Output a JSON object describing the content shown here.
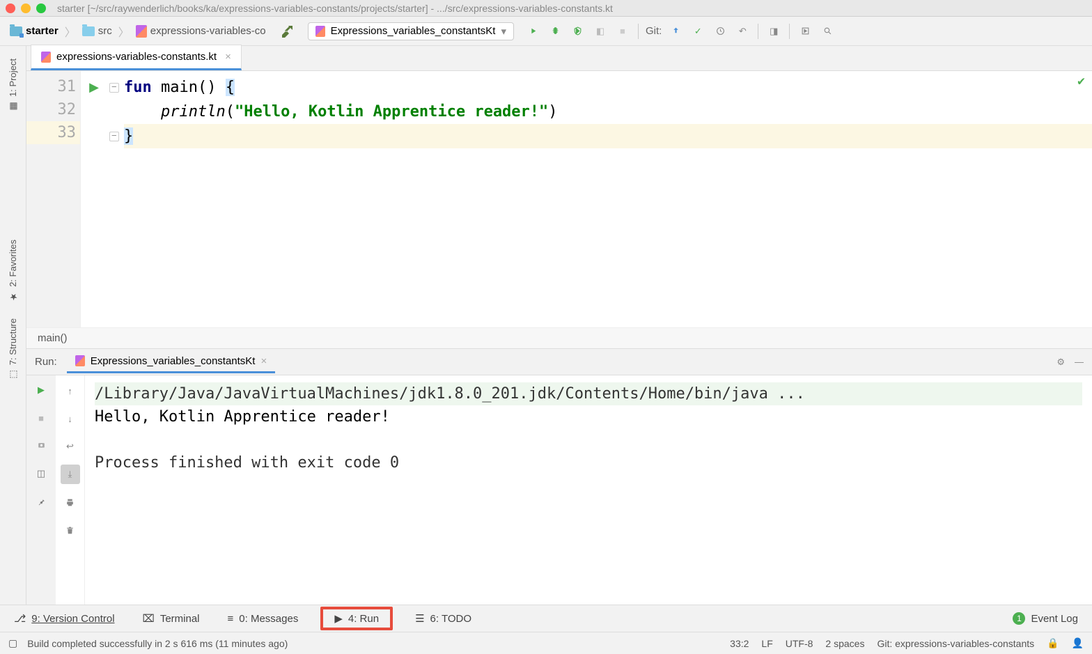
{
  "titlebar": {
    "title": "starter [~/src/raywenderlich/books/ka/expressions-variables-constants/projects/starter] - .../src/expressions-variables-constants.kt"
  },
  "breadcrumb": {
    "project": "starter",
    "folder": "src",
    "file": "expressions-variables-co"
  },
  "run_config": {
    "name": "Expressions_variables_constantsKt"
  },
  "git_label": "Git:",
  "editor": {
    "tab_name": "expressions-variables-constants.kt",
    "line_numbers": [
      "31",
      "32",
      "33"
    ],
    "code": {
      "line1_kw": "fun",
      "line1_rest": " main() ",
      "line1_brace": "{",
      "line2_indent": "    ",
      "line2_fn": "println",
      "line2_open": "(",
      "line2_str": "\"Hello, Kotlin Apprentice reader!\"",
      "line2_close": ")",
      "line3_brace": "}"
    },
    "breadcrumb": "main()"
  },
  "side_tabs": {
    "project": "1: Project",
    "favorites": "2: Favorites",
    "structure": "7: Structure"
  },
  "run_panel": {
    "label": "Run:",
    "tab": "Expressions_variables_constantsKt",
    "console": {
      "cmd": "/Library/Java/JavaVirtualMachines/jdk1.8.0_201.jdk/Contents/Home/bin/java ...",
      "out": "Hello, Kotlin Apprentice reader!",
      "exit": "Process finished with exit code 0"
    }
  },
  "bottom_bar": {
    "vcs": "9: Version Control",
    "terminal": "Terminal",
    "messages": "0: Messages",
    "run": "4: Run",
    "todo": "6: TODO",
    "event_log": "Event Log",
    "event_count": "1"
  },
  "status_bar": {
    "message": "Build completed successfully in 2 s 616 ms (11 minutes ago)",
    "pos": "33:2",
    "sep": "LF",
    "enc": "UTF-8",
    "indent": "2 spaces",
    "branch": "Git: expressions-variables-constants"
  }
}
